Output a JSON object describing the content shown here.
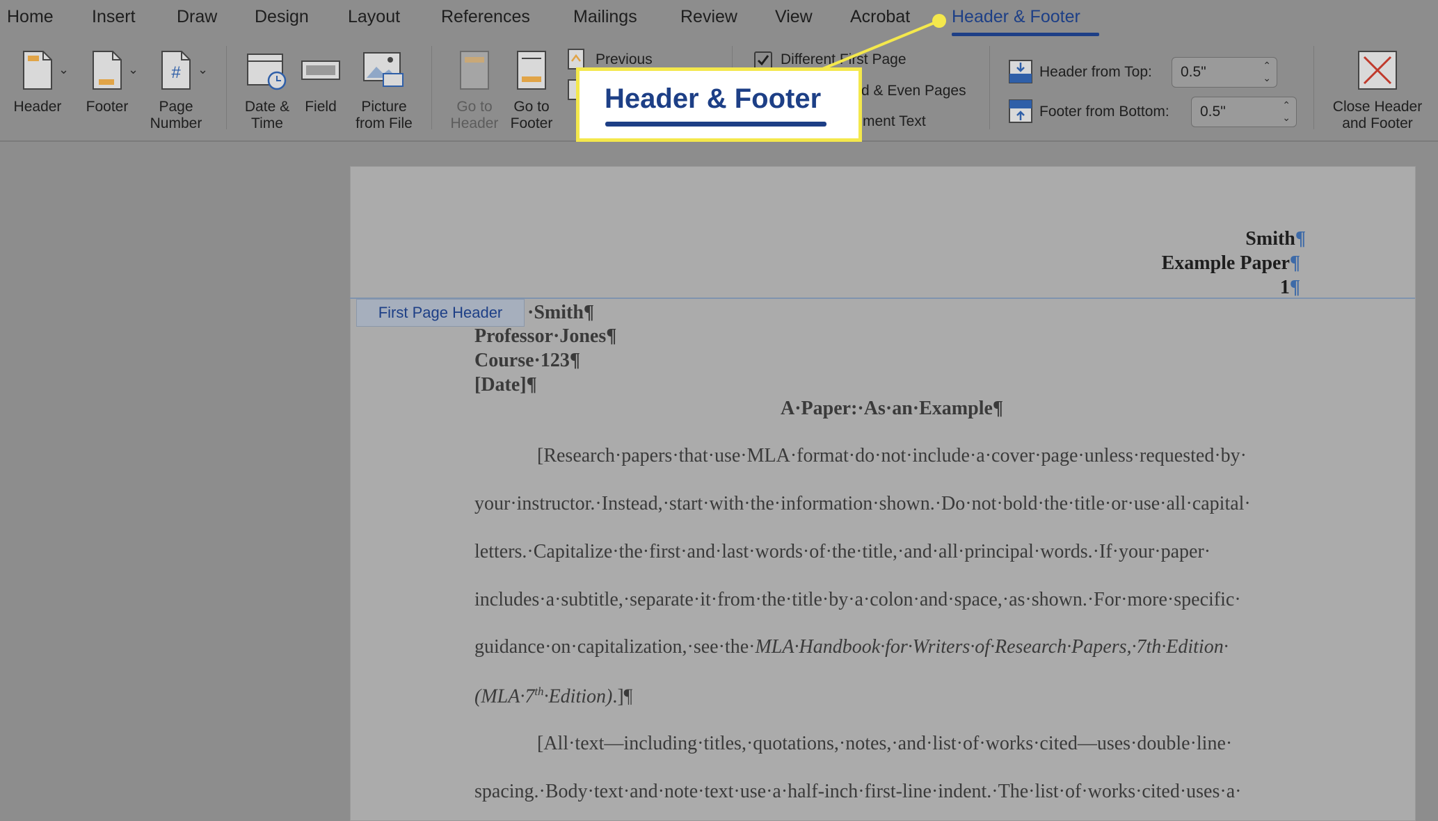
{
  "tabs": [
    {
      "label": "Home"
    },
    {
      "label": "Insert"
    },
    {
      "label": "Draw"
    },
    {
      "label": "Design"
    },
    {
      "label": "Layout"
    },
    {
      "label": "References"
    },
    {
      "label": "Mailings"
    },
    {
      "label": "Review"
    },
    {
      "label": "View"
    },
    {
      "label": "Acrobat"
    },
    {
      "label": "Header & Footer",
      "active": true
    }
  ],
  "ribbon": {
    "header_label": "Header",
    "footer_label": "Footer",
    "page_number_label": "Page\nNumber",
    "date_time_label": "Date &\nTime",
    "field_label": "Field",
    "picture_label": "Picture\nfrom File",
    "go_to_header_label": "Go to\nHeader",
    "go_to_footer_label": "Go to\nFooter",
    "previous_label": "Previous",
    "different_first_page_label": "Different First Page",
    "different_first_page_checked": true,
    "odd_even_label": "d & Even Pages",
    "document_text_label": "ment Text",
    "header_from_top_label": "Header from Top:",
    "header_from_top_value": "0.5\"",
    "footer_from_bottom_label": "Footer from Bottom:",
    "footer_from_bottom_value": "0.5\"",
    "close_label": "Close Header\nand Footer"
  },
  "callout": {
    "text": "Header & Footer",
    "border_color": "#f4e84c",
    "text_color": "#1d3f86"
  },
  "document": {
    "header_right": [
      "Smith",
      "Example Paper",
      "1"
    ],
    "header_marks": [
      "¶",
      "¶",
      "¶"
    ],
    "first_page_header_tag": "First Page Header",
    "heading_lines": [
      "·Smith¶",
      "Professor·Jones¶",
      "Course·123¶",
      "[Date]¶"
    ],
    "title": "A·Paper:·As·an·Example¶",
    "body_lines": [
      "[Research·papers·that·use·MLA·format·do·not·include·a·cover·page·unless·requested·by·",
      "your·instructor.·Instead,·start·with·the·information·shown.·Do·not·bold·the·title·or·use·all·capital·",
      "letters.·Capitalize·the·first·and·last·words·of·the·title,·and·all·principal·words.·If·your·paper·",
      "includes·a·subtitle,·separate·it·from·the·title·by·a·colon·and·space,·as·shown.·For·more·specific·",
      "guidance·on·capitalization,·see·the·",
      "",
      "[All·text—including·titles,·quotations,·notes,·and·list·of·works·cited—uses·double·line·",
      "spacing.·Body·text·and·note·text·use·a·half-inch·first-line·indent.·The·list·of·works·cited·uses·a·"
    ],
    "italic_ref": "MLA·Handbook·for·Writers·of·Research·Papers,·7th·Edition·",
    "line6_italic_a": "(MLA·7",
    "line6_sup": "th",
    "line6_italic_b": "·Edition)",
    "line6_tail": ".]¶"
  },
  "colors": {
    "accent": "#1d3f86",
    "highlight": "#f4e84c",
    "background": "#8d8d8d",
    "page": "#ababab"
  }
}
